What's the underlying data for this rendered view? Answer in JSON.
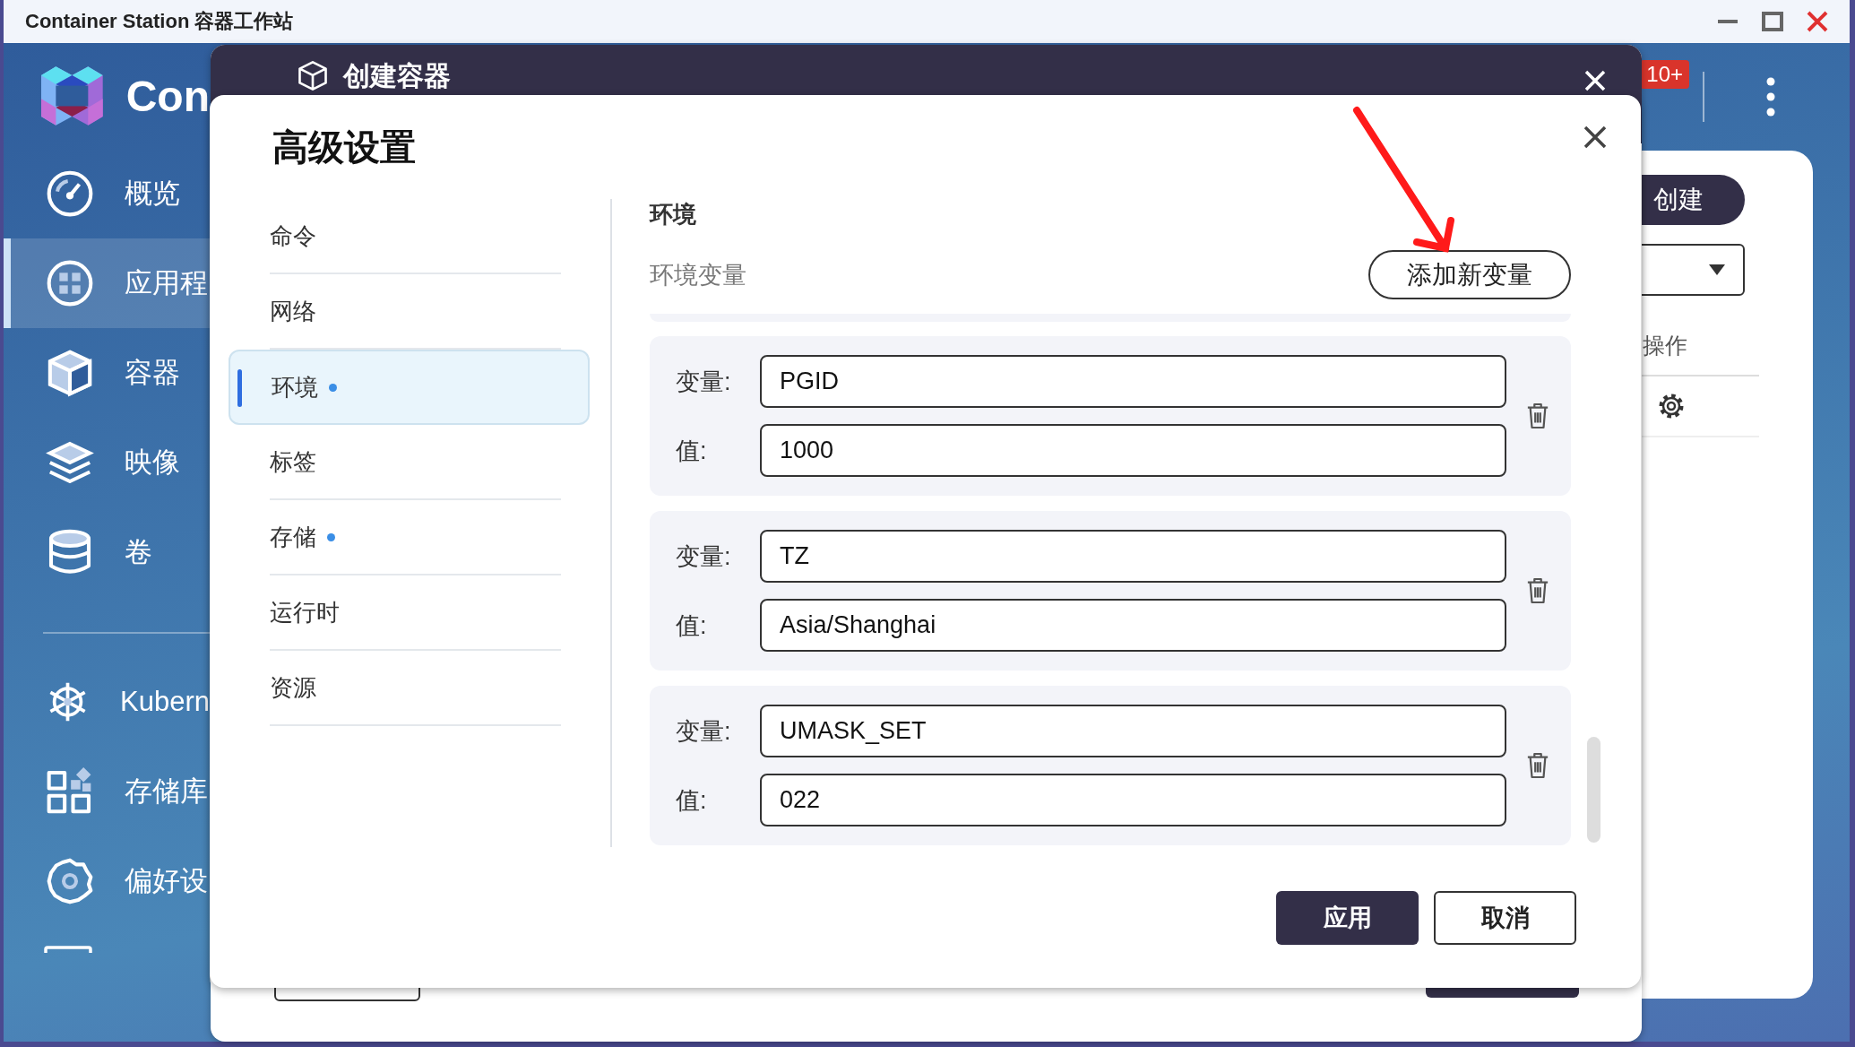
{
  "window": {
    "title": "Container Station 容器工作站"
  },
  "sidebar": {
    "logo_text": "Con",
    "items": [
      {
        "label": "概览",
        "kind": "overview",
        "selected": false
      },
      {
        "label": "应用程",
        "kind": "apps",
        "selected": true
      },
      {
        "label": "容器",
        "kind": "containers",
        "selected": false
      },
      {
        "label": "映像",
        "kind": "images",
        "selected": false
      },
      {
        "label": "卷",
        "kind": "volumes",
        "selected": false
      },
      {
        "label": "Kubern",
        "kind": "kubernetes",
        "selected": false,
        "group_start": true
      },
      {
        "label": "存储库",
        "kind": "registry",
        "selected": false
      },
      {
        "label": "偏好设",
        "kind": "preferences",
        "selected": false
      }
    ]
  },
  "topbar": {
    "notification_badge": "10+"
  },
  "panel": {
    "create_button": "创建",
    "column_header": "操作"
  },
  "create_dialog": {
    "title": "创建容器"
  },
  "advanced_dialog": {
    "title": "高级设置",
    "menu": [
      {
        "label": "命令",
        "selected": false,
        "changed": false
      },
      {
        "label": "网络",
        "selected": false,
        "changed": false
      },
      {
        "label": "环境",
        "selected": true,
        "changed": true
      },
      {
        "label": "标签",
        "selected": false,
        "changed": false
      },
      {
        "label": "存储",
        "selected": false,
        "changed": true
      },
      {
        "label": "运行时",
        "selected": false,
        "changed": false
      },
      {
        "label": "资源",
        "selected": false,
        "changed": false
      }
    ],
    "section_title": "环境",
    "subsection_title": "环境变量",
    "add_button": "添加新变量",
    "variables": [
      {
        "name_label": "变量:",
        "name": "PGID",
        "value_label": "值:",
        "value": "1000"
      },
      {
        "name_label": "变量:",
        "name": "TZ",
        "value_label": "值:",
        "value": "Asia/Shanghai"
      },
      {
        "name_label": "变量:",
        "name": "UMASK_SET",
        "value_label": "值:",
        "value": "022"
      }
    ],
    "buttons": [
      {
        "label": "应用",
        "kind": "primary"
      },
      {
        "label": "取消",
        "kind": "secondary"
      }
    ]
  }
}
